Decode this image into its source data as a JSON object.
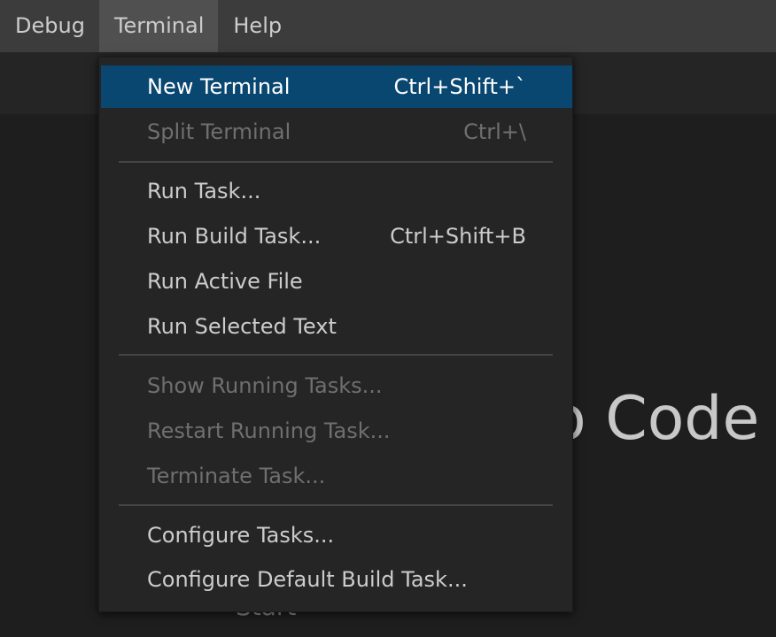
{
  "menubar": {
    "items": [
      {
        "label": "Debug"
      },
      {
        "label": "Terminal"
      },
      {
        "label": "Help"
      }
    ]
  },
  "welcome": {
    "title_fragment": "o Code",
    "subtitle_fragment": "Start"
  },
  "terminal_menu": {
    "items": [
      {
        "label": "New Terminal",
        "shortcut": "Ctrl+Shift+`",
        "state": "highlighted"
      },
      {
        "label": "Split Terminal",
        "shortcut": "Ctrl+\\",
        "state": "disabled"
      },
      {
        "label": "Run Task...",
        "shortcut": "",
        "state": "enabled"
      },
      {
        "label": "Run Build Task...",
        "shortcut": "Ctrl+Shift+B",
        "state": "enabled"
      },
      {
        "label": "Run Active File",
        "shortcut": "",
        "state": "enabled"
      },
      {
        "label": "Run Selected Text",
        "shortcut": "",
        "state": "enabled"
      },
      {
        "label": "Show Running Tasks...",
        "shortcut": "",
        "state": "disabled"
      },
      {
        "label": "Restart Running Task...",
        "shortcut": "",
        "state": "disabled"
      },
      {
        "label": "Terminate Task...",
        "shortcut": "",
        "state": "disabled"
      },
      {
        "label": "Configure Tasks...",
        "shortcut": "",
        "state": "enabled"
      },
      {
        "label": "Configure Default Build Task...",
        "shortcut": "",
        "state": "enabled"
      }
    ]
  },
  "colors": {
    "menubar_bg": "#3c3c3c",
    "menu_bg": "#252526",
    "selection_bg": "#094771",
    "text": "#cccccc",
    "disabled_text": "#6f6f6f"
  }
}
